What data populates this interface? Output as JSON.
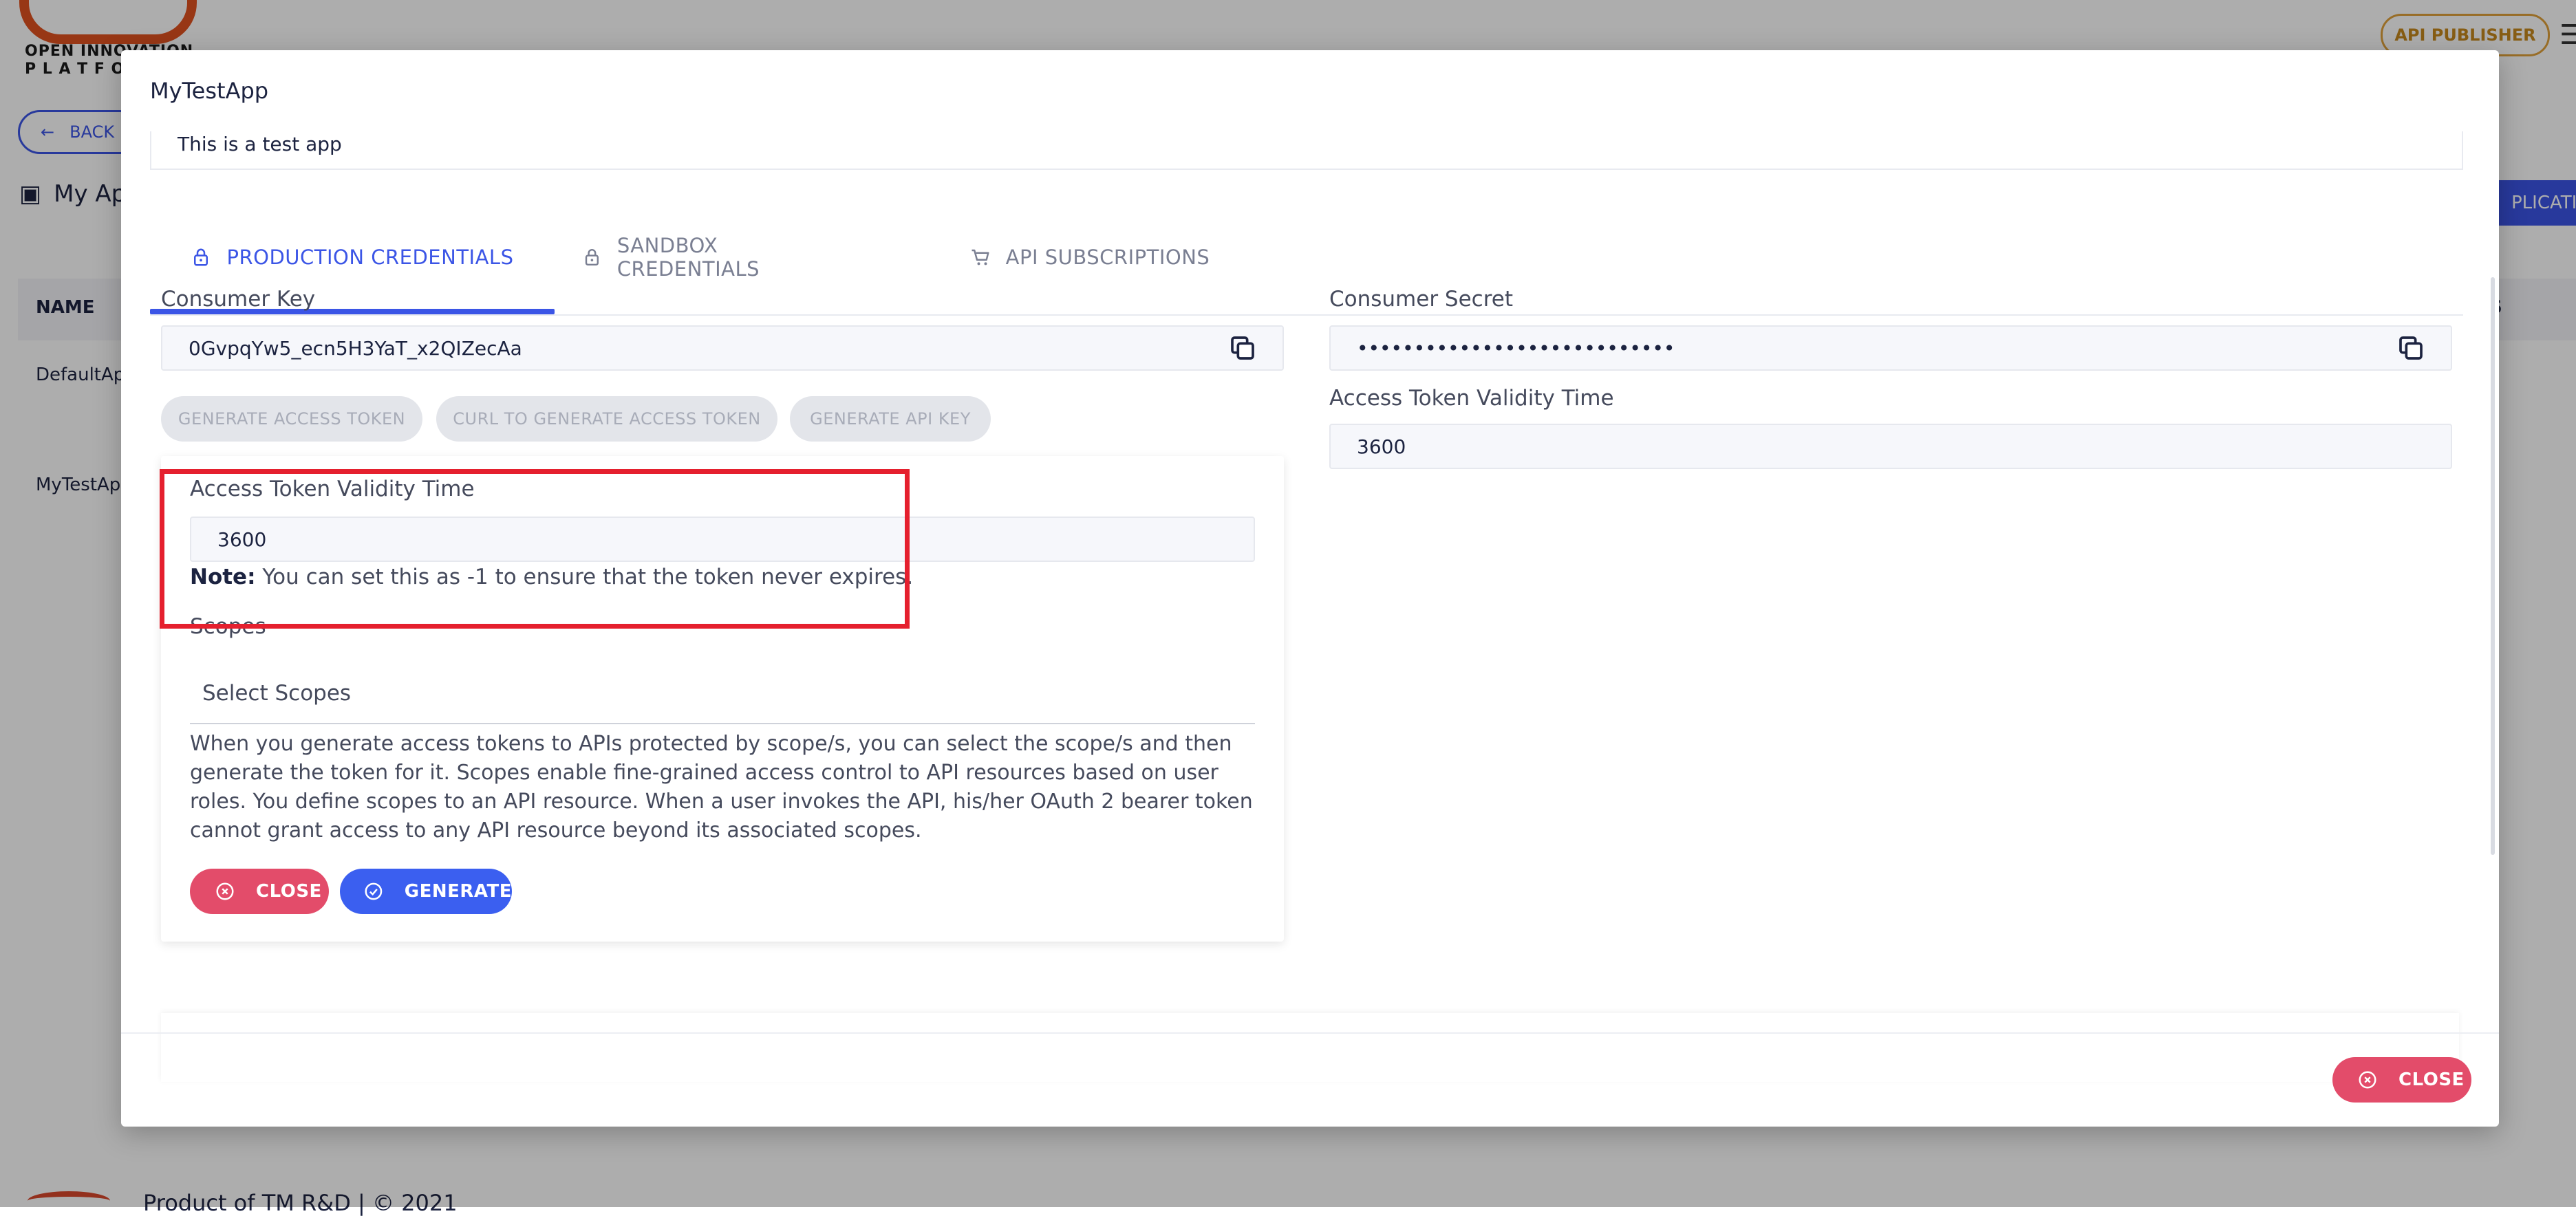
{
  "background": {
    "logo_text": "OPEN INNOVATION\nP L A T F O",
    "publisher_button": "API PUBLISHER",
    "back_button": "BACK",
    "my_apps_title": "My Ap",
    "add_application_button": "PLICATION",
    "table": {
      "name_header": "NAME",
      "last_header": "S",
      "rows": [
        "DefaultAp",
        "MyTestAp"
      ]
    },
    "footer_text": "Product of TM R&D | © 2021"
  },
  "modal": {
    "title": "MyTestApp",
    "description": "This is a test app",
    "tabs": [
      {
        "label": "PRODUCTION CREDENTIALS",
        "icon": "lock-icon",
        "active": true
      },
      {
        "label": "SANDBOX CREDENTIALS",
        "icon": "lock-icon",
        "active": false
      },
      {
        "label": "API SUBSCRIPTIONS",
        "icon": "cart-icon",
        "active": false
      }
    ],
    "consumer_key": {
      "label": "Consumer Key",
      "value": "0GvpqYw5_ecn5H3YaT_x2QIZecAa"
    },
    "consumer_secret": {
      "label": "Consumer Secret",
      "value": "••••••••••••••••••••••••••••"
    },
    "right_validity": {
      "label": "Access Token Validity Time",
      "value": "3600"
    },
    "action_buttons": {
      "generate_access_token": "GENERATE ACCESS TOKEN",
      "curl_token": "CURL TO GENERATE ACCESS TOKEN",
      "generate_api_key": "GENERATE API KEY"
    },
    "panel": {
      "validity_label": "Access Token Validity Time",
      "validity_value": "3600",
      "note_bold": "Note:",
      "note_text": " You can set this as -1 to ensure that the token never expires.",
      "scopes_label": "Scopes",
      "scopes_placeholder": "Select Scopes",
      "scopes_help": "When you generate access tokens to APIs protected by scope/s, you can select the scope/s and then generate the token for it. Scopes enable fine-grained access control to API resources based on user roles. You define scopes to an API resource. When a user invokes the API, his/her OAuth 2 bearer token cannot grant access to any API resource beyond its associated scopes.",
      "close_button": "CLOSE",
      "generate_button": "GENERATE"
    },
    "footer_close_button": "CLOSE"
  },
  "colors": {
    "primary": "#3b55e6",
    "danger": "#e34c6a",
    "highlight": "#e5202e",
    "publisher": "#e0a13a"
  }
}
